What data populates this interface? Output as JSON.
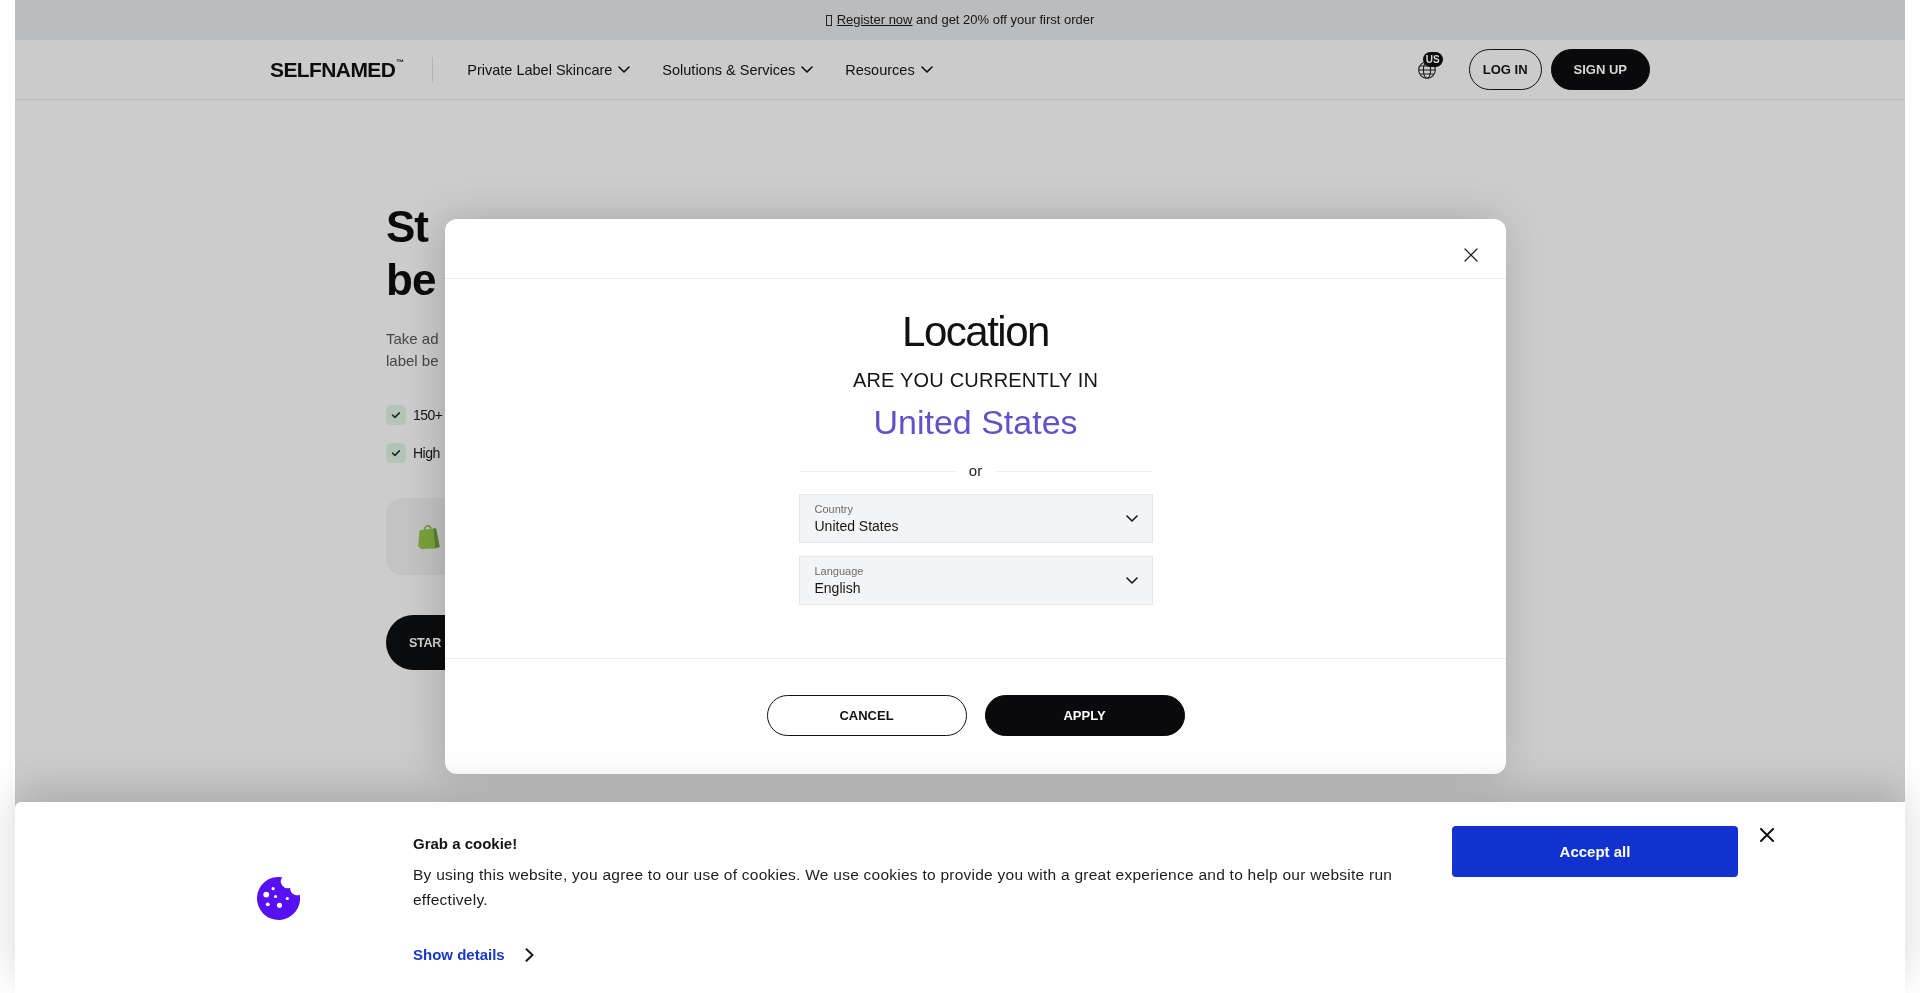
{
  "promo_bar": {
    "link": "Register now",
    "text": "and get 20% off your first order"
  },
  "header": {
    "logo": "SELFNAMED$^{™}$",
    "nav": [
      "Private Label Skincare",
      "Solutions & Services",
      "Resources"
    ],
    "region_badge": "US",
    "buttons": [
      {
        "label": "LOG IN",
        "kind": "outline"
      },
      {
        "label": "SIGN UP",
        "kind": "filled"
      }
    ]
  },
  "hero": {
    "title_lines": [
      "St",
      "be"
    ],
    "intro_lines": [
      "Take ad",
      "label be"
    ],
    "features": [
      "150+",
      "High"
    ],
    "cta": "STAR"
  },
  "location_modal": {
    "title": "Location",
    "question": "ARE YOU CURRENTLY IN",
    "detected_country": "United States",
    "divider_text": "or",
    "fields": [
      {
        "label": "Country",
        "value": "United States"
      },
      {
        "label": "Language",
        "value": "English"
      }
    ],
    "buttons": [
      {
        "label": "CANCEL",
        "kind": "outline"
      },
      {
        "label": "APPLY",
        "kind": "filled"
      }
    ]
  },
  "cookie_banner": {
    "title": "Grab a cookie!",
    "text": "By using this website, you agree to our use of cookies. We use cookies to provide you with a great experience and to help our website run effectively.",
    "link": "Show details",
    "button": "Accept all"
  }
}
